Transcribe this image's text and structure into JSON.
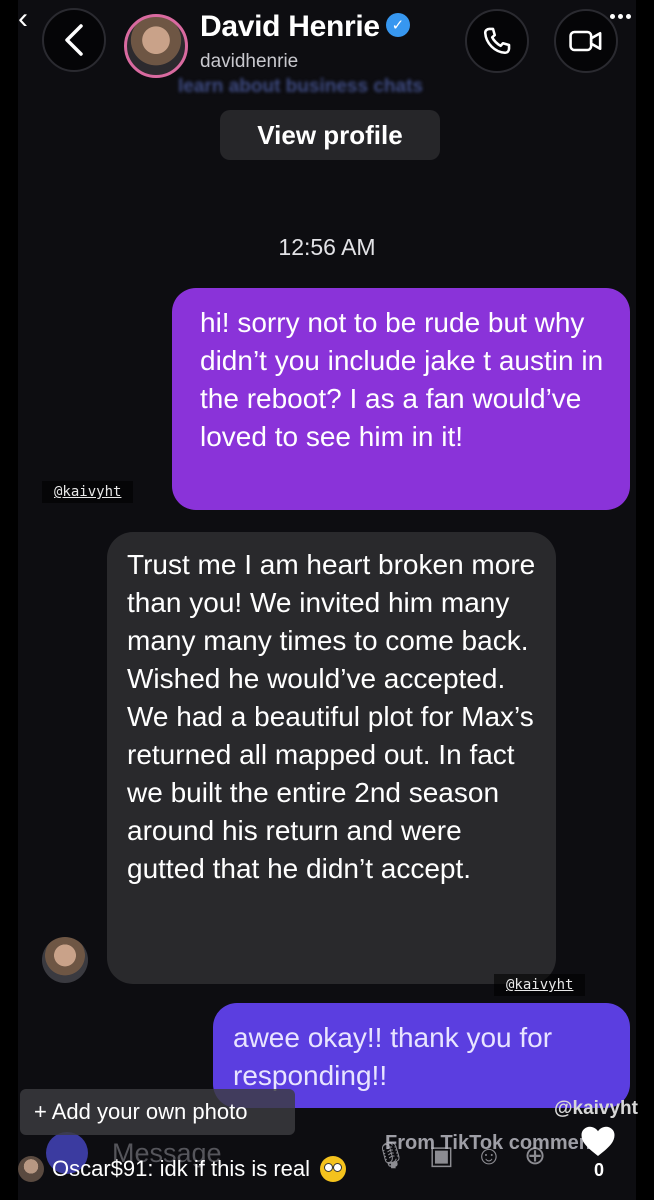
{
  "header": {
    "contact_name": "David Henrie",
    "contact_handle": "davidhenrie",
    "verified": true,
    "background_text": "learn about business chats",
    "view_profile_label": "View profile"
  },
  "thread": {
    "timestamp": "12:56 AM",
    "messages": [
      {
        "direction": "outgoing",
        "text": "hi! sorry not to be rude but why didn’t you include jake t austin in the reboot? I as a fan would’ve loved to see him in it!"
      },
      {
        "direction": "incoming",
        "text": "Trust me I am heart broken more than you! We invited him many many many times to come back. Wished he would’ve accepted. We had a beautiful plot for Max’s returned all mapped out. In fact we built the entire 2nd season around his return and were gutted that he didn’t accept."
      },
      {
        "direction": "outgoing",
        "text": "awee okay!! thank you for responding!!"
      }
    ],
    "watermarks": [
      "@kaivyht",
      "@kaivyht"
    ]
  },
  "composer": {
    "placeholder": "Message"
  },
  "tiktok_overlay": {
    "add_photo_label": "+ Add your own photo",
    "credit": "@kaivyht",
    "source_label": "From TikTok comment",
    "like_count": "0",
    "comment_user": "Oscar$91",
    "comment_text": "idk if this is real"
  },
  "colors": {
    "background": "#0d0d11",
    "outgoing_bubble": "#8a33d9",
    "outgoing_bubble_alt": "#5b3ee0",
    "incoming_bubble": "#29292c",
    "verified_badge": "#3797f0"
  }
}
